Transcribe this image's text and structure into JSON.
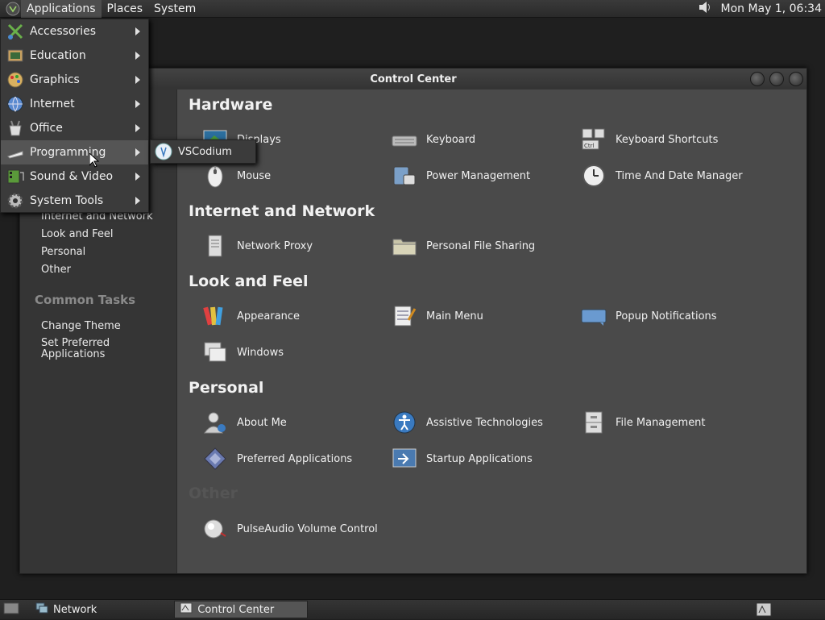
{
  "top_panel": {
    "menus": [
      "Applications",
      "Places",
      "System"
    ],
    "clock": "Mon May  1, 06:34",
    "volume_icon": "speaker-icon"
  },
  "window": {
    "title": "Control Center"
  },
  "sidebar": {
    "links_top": [
      "Internet and Network",
      "Look and Feel",
      "Personal",
      "Other"
    ],
    "common_tasks_heading": "Common Tasks",
    "tasks": [
      "Change Theme",
      "Set Preferred Applications"
    ]
  },
  "content": {
    "sections": [
      {
        "title": "Hardware",
        "items": [
          "Displays",
          "Keyboard",
          "Keyboard Shortcuts",
          "Mouse",
          "Power Management",
          "Time And Date Manager"
        ]
      },
      {
        "title": "Internet and Network",
        "items": [
          "Network Proxy",
          "Personal File Sharing"
        ]
      },
      {
        "title": "Look and Feel",
        "items": [
          "Appearance",
          "Main Menu",
          "Popup Notifications",
          "Windows"
        ]
      },
      {
        "title": "Personal",
        "items": [
          "About Me",
          "Assistive Technologies",
          "File Management",
          "Preferred Applications",
          "Startup Applications"
        ]
      },
      {
        "title": "Other",
        "items": [
          "PulseAudio Volume Control"
        ]
      }
    ]
  },
  "app_menu": {
    "items": [
      "Accessories",
      "Education",
      "Graphics",
      "Internet",
      "Office",
      "Programming",
      "Sound & Video",
      "System Tools"
    ],
    "highlighted": "Programming",
    "submenu_item": "VSCodium"
  },
  "bottom_panel": {
    "tasks": [
      "Network",
      "Control Center"
    ],
    "active_task": "Control Center"
  },
  "colors": {
    "panel": "#2f2f2f",
    "window_bg": "#353535",
    "content_bg": "#4a4a4a",
    "highlight": "#555555"
  }
}
